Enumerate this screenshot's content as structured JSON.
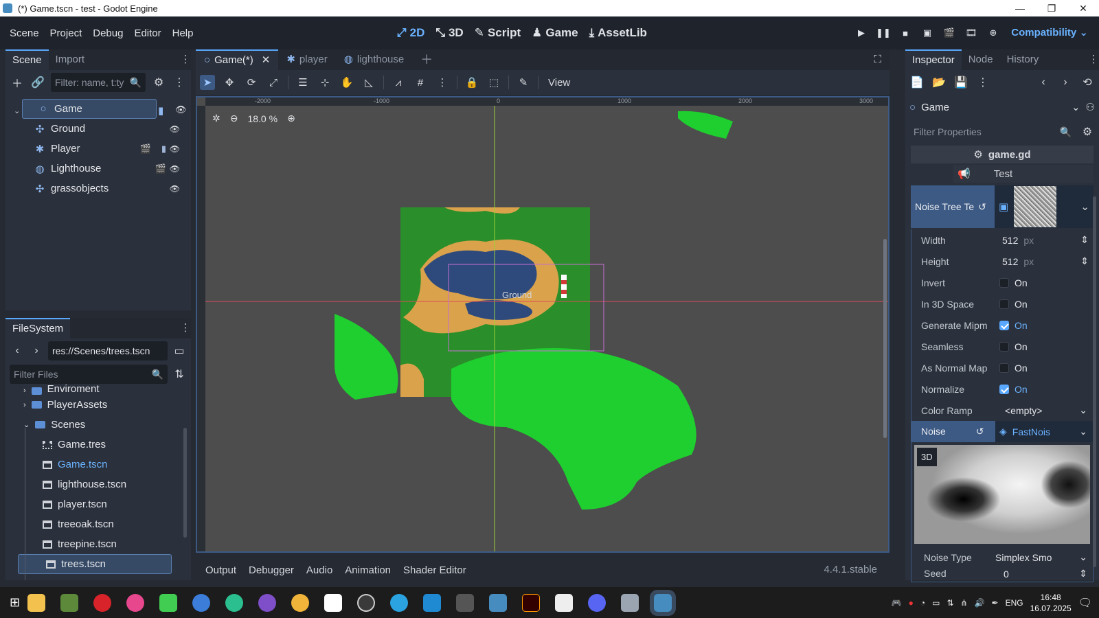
{
  "window": {
    "title": "(*) Game.tscn - test - Godot Engine",
    "min": "—",
    "max": "❐",
    "close": "✕"
  },
  "menu": [
    "Scene",
    "Project",
    "Debug",
    "Editor",
    "Help"
  ],
  "workspaces": [
    {
      "label": "2D",
      "icon": "2d-icon",
      "active": true
    },
    {
      "label": "3D",
      "icon": "3d-icon"
    },
    {
      "label": "Script",
      "icon": "script-icon"
    },
    {
      "label": "Game",
      "icon": "game-icon"
    },
    {
      "label": "AssetLib",
      "icon": "assetlib-icon"
    }
  ],
  "renderer": "Compatibility",
  "scene_panel": {
    "tabs": [
      "Scene",
      "Import"
    ],
    "filter_placeholder": "Filter: name, t:ty",
    "nodes": [
      {
        "name": "Game",
        "icon": "node2d-icon",
        "selected": true
      },
      {
        "name": "Ground",
        "icon": "tilemap-icon"
      },
      {
        "name": "Player",
        "icon": "character-icon"
      },
      {
        "name": "Lighthouse",
        "icon": "sprite-icon"
      },
      {
        "name": "grassobjects",
        "icon": "tilemap-icon"
      }
    ]
  },
  "filesystem": {
    "tab": "FileSystem",
    "path": "res://Scenes/trees.tscn",
    "filter_placeholder": "Filter Files",
    "items": [
      {
        "name": "Enviroment",
        "type": "folder",
        "indent": 1
      },
      {
        "name": "PlayerAssets",
        "type": "folder",
        "indent": 1
      },
      {
        "name": "Scenes",
        "type": "folder",
        "indent": 1,
        "open": true
      },
      {
        "name": "Game.tres",
        "type": "file",
        "indent": 2
      },
      {
        "name": "Game.tscn",
        "type": "file",
        "indent": 2,
        "highlight": true
      },
      {
        "name": "lighthouse.tscn",
        "type": "file",
        "indent": 2
      },
      {
        "name": "player.tscn",
        "type": "file",
        "indent": 2
      },
      {
        "name": "treeoak.tscn",
        "type": "file",
        "indent": 2
      },
      {
        "name": "treepine.tscn",
        "type": "file",
        "indent": 2
      },
      {
        "name": "trees.tscn",
        "type": "file",
        "indent": 2,
        "selected": true
      }
    ]
  },
  "editor_tabs": [
    {
      "label": "Game(*)",
      "active": true,
      "close": "✕"
    },
    {
      "label": "player"
    },
    {
      "label": "lighthouse"
    }
  ],
  "view_menu": "View",
  "viewport": {
    "zoom": "18.0 %",
    "ruler_labels": [
      "-2000",
      "-1000",
      "0",
      "1000",
      "2000",
      "3000"
    ],
    "node_label": "Ground"
  },
  "bottom_tabs": [
    "Output",
    "Debugger",
    "Audio",
    "Animation",
    "Shader Editor"
  ],
  "version": "4.4.1.stable",
  "inspector": {
    "tabs": [
      "Inspector",
      "Node",
      "History"
    ],
    "object": "Game",
    "filter_placeholder": "Filter Properties",
    "script": "game.gd",
    "group": "Test",
    "resource_label": "Noise Tree Te",
    "properties": [
      {
        "name": "Width",
        "value": "512",
        "unit": "px",
        "kind": "number"
      },
      {
        "name": "Height",
        "value": "512",
        "unit": "px",
        "kind": "number"
      },
      {
        "name": "Invert",
        "value": "On",
        "kind": "check",
        "checked": false
      },
      {
        "name": "In 3D Space",
        "value": "On",
        "kind": "check",
        "checked": false
      },
      {
        "name": "Generate Mipm",
        "value": "On",
        "kind": "check",
        "checked": true
      },
      {
        "name": "Seamless",
        "value": "On",
        "kind": "check",
        "checked": false
      },
      {
        "name": "As Normal Map",
        "value": "On",
        "kind": "check",
        "checked": false
      },
      {
        "name": "Normalize",
        "value": "On",
        "kind": "check",
        "checked": true
      },
      {
        "name": "Color Ramp",
        "value": "<empty>",
        "kind": "dropdown"
      }
    ],
    "noise": {
      "name": "Noise",
      "value": "FastNois",
      "preview_badge": "3D"
    },
    "noise_type": {
      "name": "Noise Type",
      "value": "Simplex Smo"
    },
    "seed": {
      "name": "Seed",
      "value": "0"
    }
  },
  "taskbar": {
    "lang": "ENG",
    "time": "16:48",
    "date": "16.07.2025"
  }
}
